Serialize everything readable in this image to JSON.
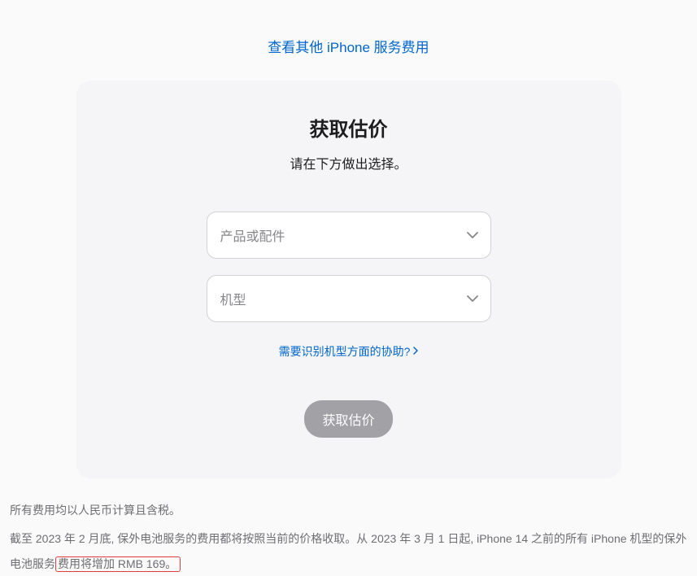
{
  "top_link": "查看其他 iPhone 服务费用",
  "card": {
    "title": "获取估价",
    "subtitle": "请在下方做出选择。",
    "select_product_placeholder": "产品或配件",
    "select_model_placeholder": "机型",
    "help_link": "需要识别机型方面的协助?",
    "submit_label": "获取估价"
  },
  "notes": {
    "line1": "所有费用均以人民币计算且含税。",
    "line2_a": "截至 2023 年 2 月底, 保外电池服务的费用都将按照当前的价格收取。从 2023 年 3 月 1 日起, iPhone 14 之前的所有 iPhone 机型的保外电池服务",
    "line2_b": "费用将增加 RMB 169。"
  }
}
